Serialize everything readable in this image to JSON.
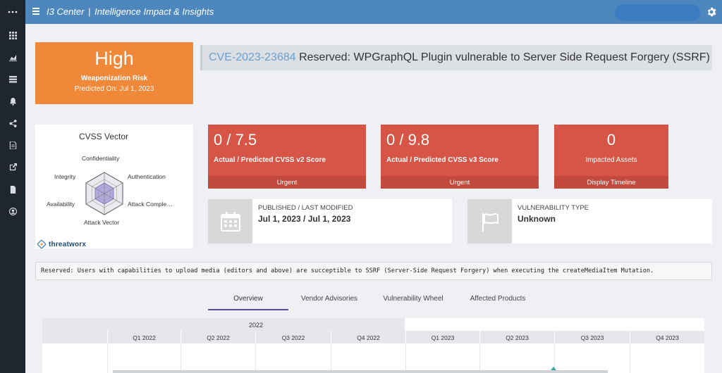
{
  "topbar": {
    "app_name": "I3 Center",
    "separator": "|",
    "app_subtitle": "Intelligence Impact & Insights",
    "accent_color": "#4d87be"
  },
  "sidebar": {
    "icons": [
      "dots-logo-icon",
      "grid-icon",
      "area-chart-icon",
      "list-icon",
      "bell-icon",
      "share-icon",
      "document-icon",
      "external-link-icon",
      "file-icon",
      "user-circle-icon"
    ]
  },
  "risk": {
    "level": "High",
    "label": "Weaponization Risk",
    "predicted": "Predicted On: Jul 1, 2023",
    "color": "#f0883a"
  },
  "cve": {
    "id": "CVE-2023-23684",
    "title": "Reserved: WPGraphQL Plugin vulnerable to Server Side Request Forgery (SSRF)"
  },
  "cvss_vector": {
    "heading": "CVSS Vector",
    "axes": [
      "Confidentiality",
      "Authentication",
      "Attack Comple…",
      "Attack Vector",
      "Availability",
      "Integrity"
    ],
    "brand": "threatworx"
  },
  "scores": [
    {
      "value": "0 / 7.5",
      "label": "Actual / Predicted CVSS v2 Score",
      "footer": "Urgent"
    },
    {
      "value": "0 / 9.8",
      "label": "Actual / Predicted CVSS v3 Score",
      "footer": "Urgent"
    },
    {
      "value": "0",
      "label": "Impacted Assets",
      "footer": "Display Timeline"
    }
  ],
  "published": {
    "title": "PUBLISHED / LAST MODIFIED",
    "value": "Jul 1, 2023 / Jul 1, 2023"
  },
  "vuln_type": {
    "title": "VULNERABILITY TYPE",
    "value": "Unknown"
  },
  "description": "Reserved: Users with capabilities to upload media (editors and above) are succeptible to SSRF (Server-Side Request Forgery) when executing the createMediaItem Mutation.",
  "tabs": [
    "Overview",
    "Vendor Advisories",
    "Vulnerability Wheel",
    "Affected Products"
  ],
  "active_tab": "Overview",
  "timeline": {
    "year": "2022",
    "quarters": [
      "Q1 2022",
      "Q2 2022",
      "Q3 2022",
      "Q4 2022",
      "Q1 2023",
      "Q2 2023",
      "Q3 2023",
      "Q4 2023"
    ]
  }
}
